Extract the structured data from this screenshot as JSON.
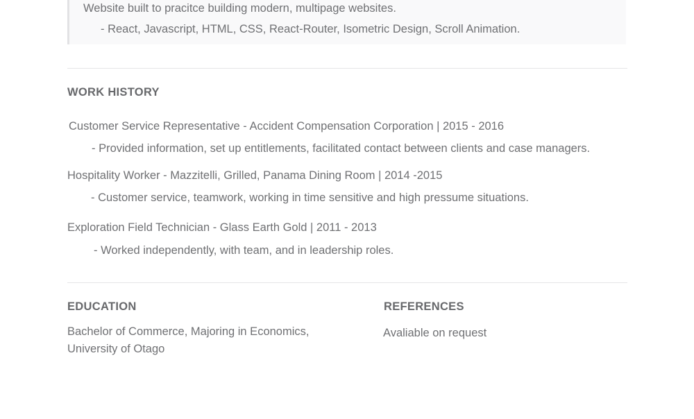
{
  "project": {
    "description": "Website built to pracitce building modern, multipage websites.",
    "tech": "- React, Javascript, HTML, CSS, React-Router, Isometric Design, Scroll Animation."
  },
  "work_history": {
    "title": "WORK HISTORY",
    "jobs": [
      {
        "title": "Customer Service Representative - Accident Compensation Corporation | 2015 - 2016",
        "description": "- Provided information, set up entitlements, facilitated contact between clients and case managers."
      },
      {
        "title": "Hospitality Worker - Mazzitelli, Grilled, Panama Dining Room | 2014 -2015",
        "description": "- Customer service, teamwork, working in time sensitive and high pressume situations."
      },
      {
        "title": "Exploration Field Technician - Glass Earth Gold | 2011 - 2013",
        "description": "- Worked independently, with team, and in leadership roles."
      }
    ]
  },
  "education": {
    "title": "EDUCATION",
    "line1": "Bachelor of Commerce, Majoring in Economics,",
    "line2": "University of Otago"
  },
  "references": {
    "title": "REFERENCES",
    "text": "Avaliable on request"
  }
}
